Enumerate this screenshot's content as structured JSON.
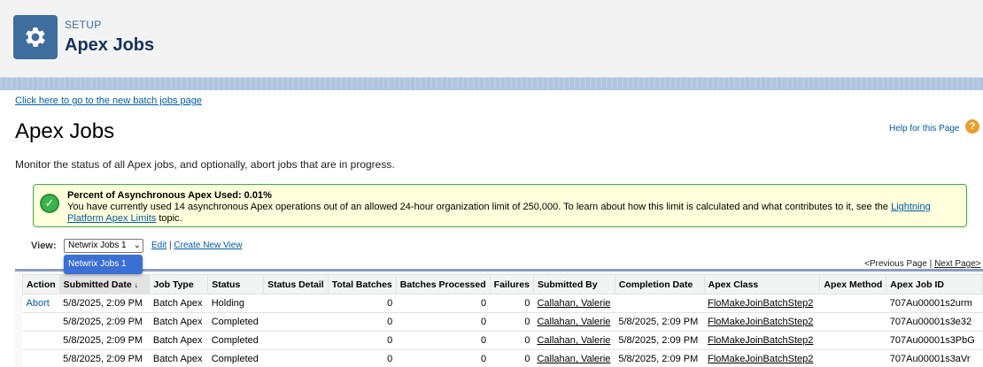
{
  "header": {
    "section": "SETUP",
    "title": "Apex Jobs",
    "icon": "gear-icon",
    "icon_color": "#3e6d9e"
  },
  "page": {
    "new_batch_link": "Click here to go to the new batch jobs page",
    "title": "Apex Jobs",
    "help_link": "Help for this Page",
    "help_icon": "?",
    "description": "Monitor the status of all Apex jobs, and optionally, abort jobs that are in progress."
  },
  "info": {
    "title": "Percent of Asynchronous Apex Used: 0.01%",
    "text": "You have currently used 14 asynchronous Apex operations out of an allowed 24-hour organization limit of 250,000. To learn about how this limit is calculated and what contributes to it, see the ",
    "link": "Lightning Platform Apex Limits",
    "suffix": " topic."
  },
  "view": {
    "label": "View:",
    "selected": "Netwrix Jobs 1",
    "edit": "Edit",
    "separator": "|",
    "create": "Create New View",
    "dropdown_option": "Netwrix Jobs 1"
  },
  "pager": {
    "prev": "<Previous Page",
    "sep": "|",
    "next": "Next Page>"
  },
  "table": {
    "headers": [
      "Action",
      "Submitted Date",
      "Job Type",
      "Status",
      "Status Detail",
      "Total Batches",
      "Batches Processed",
      "Failures",
      "Submitted By",
      "Completion Date",
      "Apex Class",
      "Apex Method",
      "Apex Job ID"
    ],
    "sort_indicator": "↓",
    "rows": [
      {
        "action": "Abort",
        "submitted": "5/8/2025, 2:09 PM",
        "type": "Batch Apex",
        "status": "Holding",
        "detail": "",
        "total": "0",
        "processed": "0",
        "failures": "0",
        "by": "Callahan, Valerie",
        "completed": "",
        "cls": "FloMakeJoinBatchStep2",
        "method": "",
        "id": "707Au00001s2urm"
      },
      {
        "action": "",
        "submitted": "5/8/2025, 2:09 PM",
        "type": "Batch Apex",
        "status": "Completed",
        "detail": "",
        "total": "0",
        "processed": "0",
        "failures": "0",
        "by": "Callahan, Valerie",
        "completed": "5/8/2025, 2:09 PM",
        "cls": "FloMakeJoinBatchStep2",
        "method": "",
        "id": "707Au00001s3e32"
      },
      {
        "action": "",
        "submitted": "5/8/2025, 2:09 PM",
        "type": "Batch Apex",
        "status": "Completed",
        "detail": "",
        "total": "0",
        "processed": "0",
        "failures": "0",
        "by": "Callahan, Valerie",
        "completed": "5/8/2025, 2:09 PM",
        "cls": "FloMakeJoinBatchStep2",
        "method": "",
        "id": "707Au00001s3PbG"
      },
      {
        "action": "",
        "submitted": "5/8/2025, 2:09 PM",
        "type": "Batch Apex",
        "status": "Completed",
        "detail": "",
        "total": "0",
        "processed": "0",
        "failures": "0",
        "by": "Callahan, Valerie",
        "completed": "5/8/2025, 2:09 PM",
        "cls": "FloMakeJoinBatchStep2",
        "method": "",
        "id": "707Au00001s3aVr"
      }
    ]
  }
}
